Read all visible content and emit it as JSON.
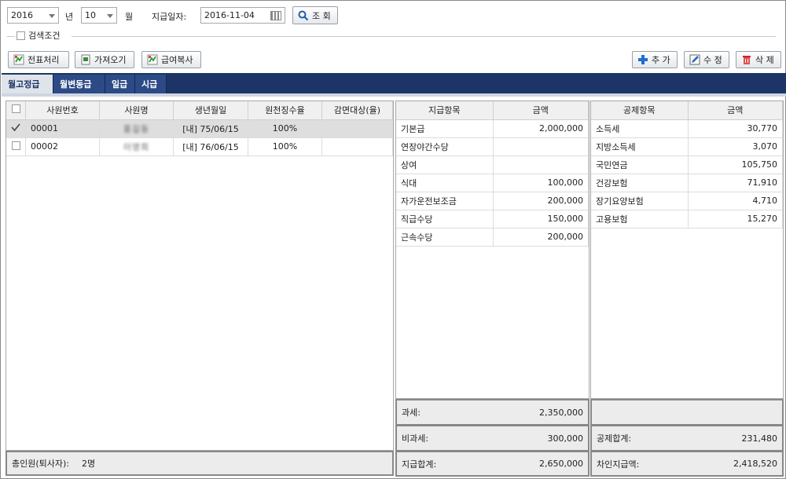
{
  "filters": {
    "year": "2016",
    "year_unit": "년",
    "month": "10",
    "month_unit": "월",
    "pay_date_label": "지급일자:",
    "pay_date": "2016-11-04",
    "search_button": "조 회",
    "search_criteria_label": "검색조건"
  },
  "toolbar": {
    "voucher": "전표처리",
    "import": "가져오기",
    "copy_pay": "급여복사",
    "add": "추 가",
    "edit": "수 정",
    "delete": "삭 제"
  },
  "tabs": [
    "월고정급",
    "월변동급",
    "일급",
    "시급"
  ],
  "employees": {
    "columns": [
      "사원번호",
      "사원명",
      "생년월일",
      "원천징수율",
      "감면대상(율)"
    ],
    "rows": [
      {
        "checked": true,
        "id": "00001",
        "name": "홍길동",
        "birth": "[내] 75/06/15",
        "rate": "100%",
        "reduction": ""
      },
      {
        "checked": false,
        "id": "00002",
        "name": "이영희",
        "birth": "[내] 76/06/15",
        "rate": "100%",
        "reduction": ""
      }
    ]
  },
  "pay_items": {
    "columns": [
      "지급항목",
      "금액"
    ],
    "rows": [
      {
        "item": "기본급",
        "amount": "2,000,000"
      },
      {
        "item": "연장야간수당",
        "amount": ""
      },
      {
        "item": "상여",
        "amount": ""
      },
      {
        "item": "식대",
        "amount": "100,000"
      },
      {
        "item": "자가운전보조금",
        "amount": "200,000"
      },
      {
        "item": "직급수당",
        "amount": "150,000"
      },
      {
        "item": "근속수당",
        "amount": "200,000"
      }
    ]
  },
  "deduction_items": {
    "columns": [
      "공제항목",
      "금액"
    ],
    "rows": [
      {
        "item": "소득세",
        "amount": "30,770"
      },
      {
        "item": "지방소득세",
        "amount": "3,070"
      },
      {
        "item": "국민연금",
        "amount": "105,750"
      },
      {
        "item": "건강보험",
        "amount": "71,910"
      },
      {
        "item": "장기요양보험",
        "amount": "4,710"
      },
      {
        "item": "고용보험",
        "amount": "15,270"
      }
    ]
  },
  "summary": {
    "taxable_label": "과세:",
    "taxable": "2,350,000",
    "nontaxable_label": "비과세:",
    "nontaxable": "300,000",
    "pay_total_label": "지급합계:",
    "pay_total": "2,650,000",
    "deduct_total_label": "공제합계:",
    "deduct_total": "231,480",
    "net_label": "차인지급액:",
    "net": "2,418,520",
    "headcount_label": "총인원(퇴사자):",
    "headcount": "2명"
  }
}
